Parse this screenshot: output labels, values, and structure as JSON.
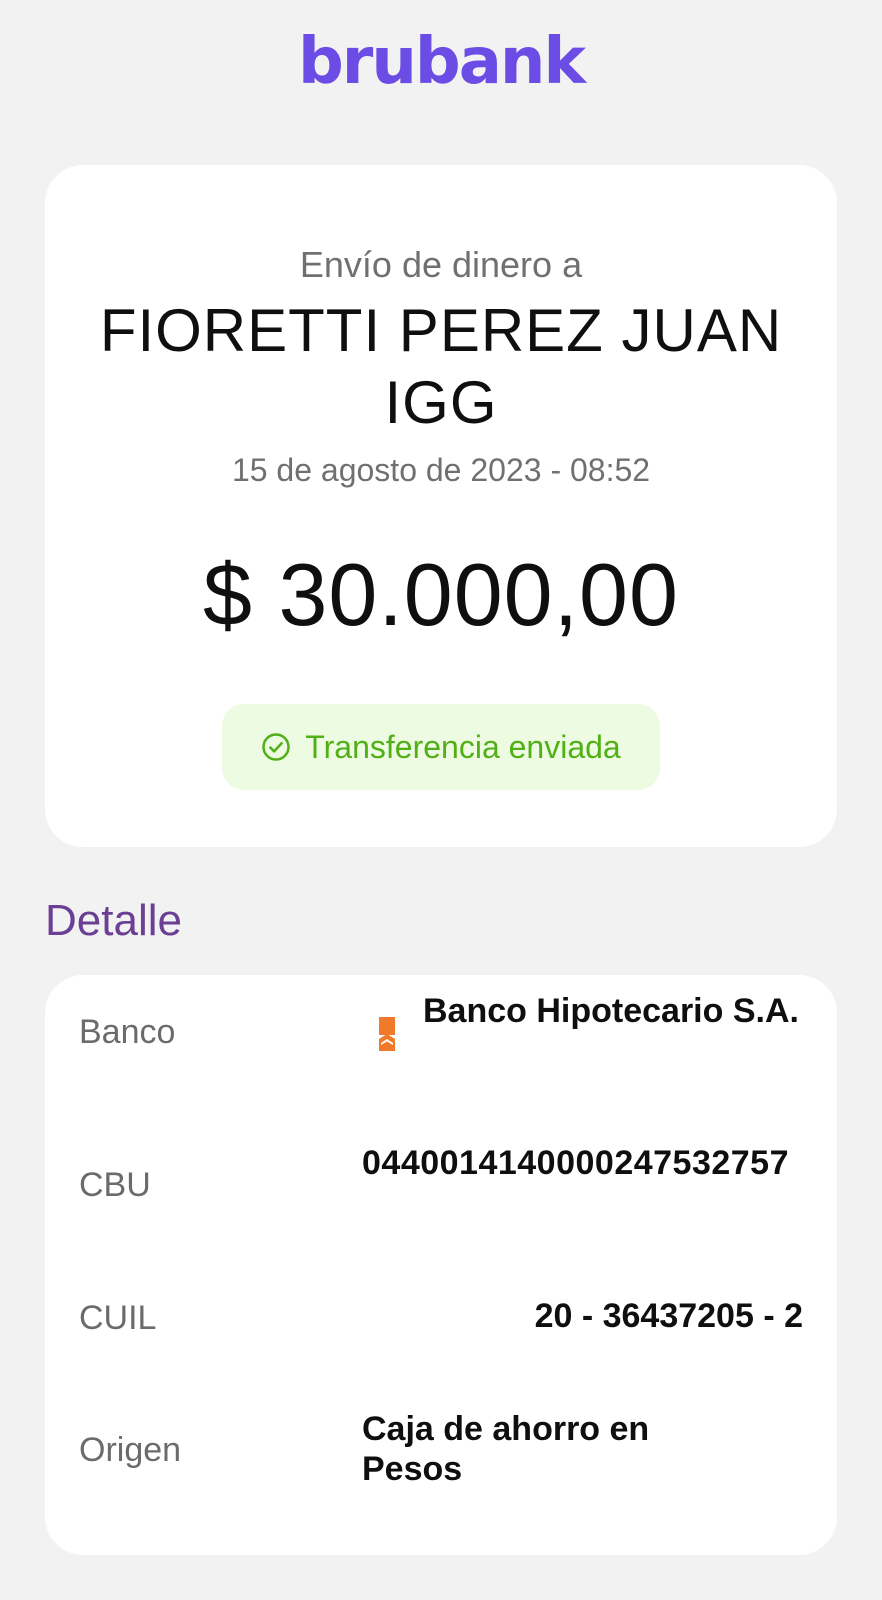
{
  "header": {
    "logo_text": "brubank",
    "brand_color": "#6b4de6"
  },
  "summary": {
    "subtitle": "Envío de dinero a",
    "recipient_name": "FIORETTI PEREZ JUAN IGG",
    "datetime": "15 de agosto de 2023 - 08:52",
    "amount": "$ 30.000,00",
    "status": {
      "label": "Transferencia enviada",
      "icon": "check-circle-icon",
      "color": "#52b016",
      "background": "#edfbe3"
    }
  },
  "details": {
    "title": "Detalle",
    "rows": [
      {
        "label": "Banco",
        "value": "Banco Hipotecario S.A.",
        "icon": "bank-logo-icon"
      },
      {
        "label": "CBU",
        "value": "0440014140000247532757"
      },
      {
        "label": "CUIL",
        "value": "20 - 36437205 - 2"
      },
      {
        "label": "Origen",
        "value": "Caja de ahorro en Pesos"
      }
    ]
  }
}
